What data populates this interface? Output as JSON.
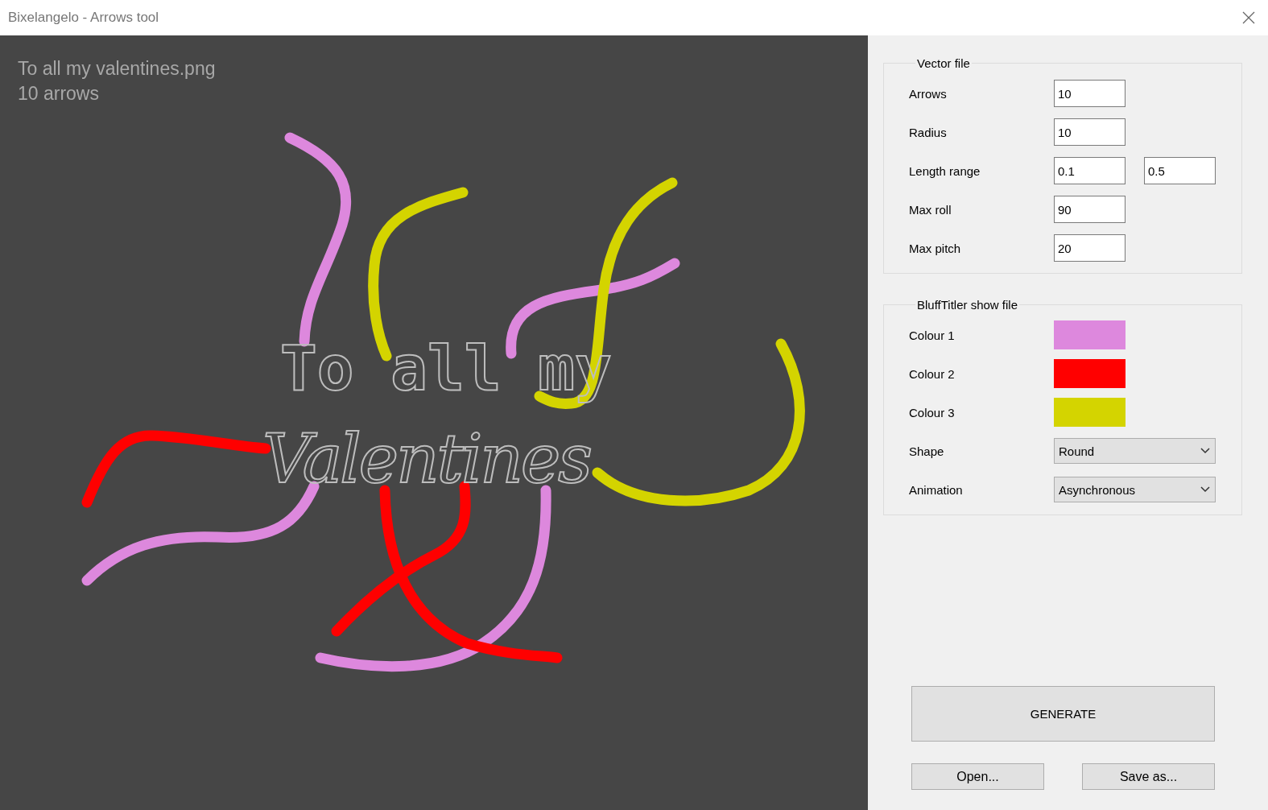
{
  "window": {
    "title": "Bixelangelo - Arrows tool"
  },
  "preview": {
    "file_name": "To all my valentines.png",
    "arrow_count": "10 arrows",
    "artwork_line_1": "To all my",
    "artwork_line_2": "Valentines"
  },
  "groups": [
    {
      "title": "Vector file",
      "rows": [
        {
          "kind": "field",
          "label": "Arrows",
          "values": [
            "10"
          ]
        },
        {
          "kind": "field",
          "label": "Radius",
          "values": [
            "10"
          ]
        },
        {
          "kind": "field",
          "label": "Length range",
          "values": [
            "0.1",
            "0.5"
          ]
        },
        {
          "kind": "field",
          "label": "Max roll",
          "values": [
            "90"
          ]
        },
        {
          "kind": "field",
          "label": "Max pitch",
          "values": [
            "20"
          ]
        }
      ]
    },
    {
      "title": "BluffTitler show file",
      "rows": [
        {
          "kind": "swatch",
          "label": "Colour 1",
          "color": "#dd88dd"
        },
        {
          "kind": "swatch",
          "label": "Colour 2",
          "color": "#ff0000"
        },
        {
          "kind": "swatch",
          "label": "Colour 3",
          "color": "#d4d400"
        },
        {
          "kind": "dropdown",
          "label": "Shape",
          "value": "Round"
        },
        {
          "kind": "dropdown",
          "label": "Animation",
          "value": "Asynchronous"
        }
      ]
    }
  ],
  "buttons": {
    "generate": "GENERATE",
    "open": "Open...",
    "save": "Save as..."
  }
}
